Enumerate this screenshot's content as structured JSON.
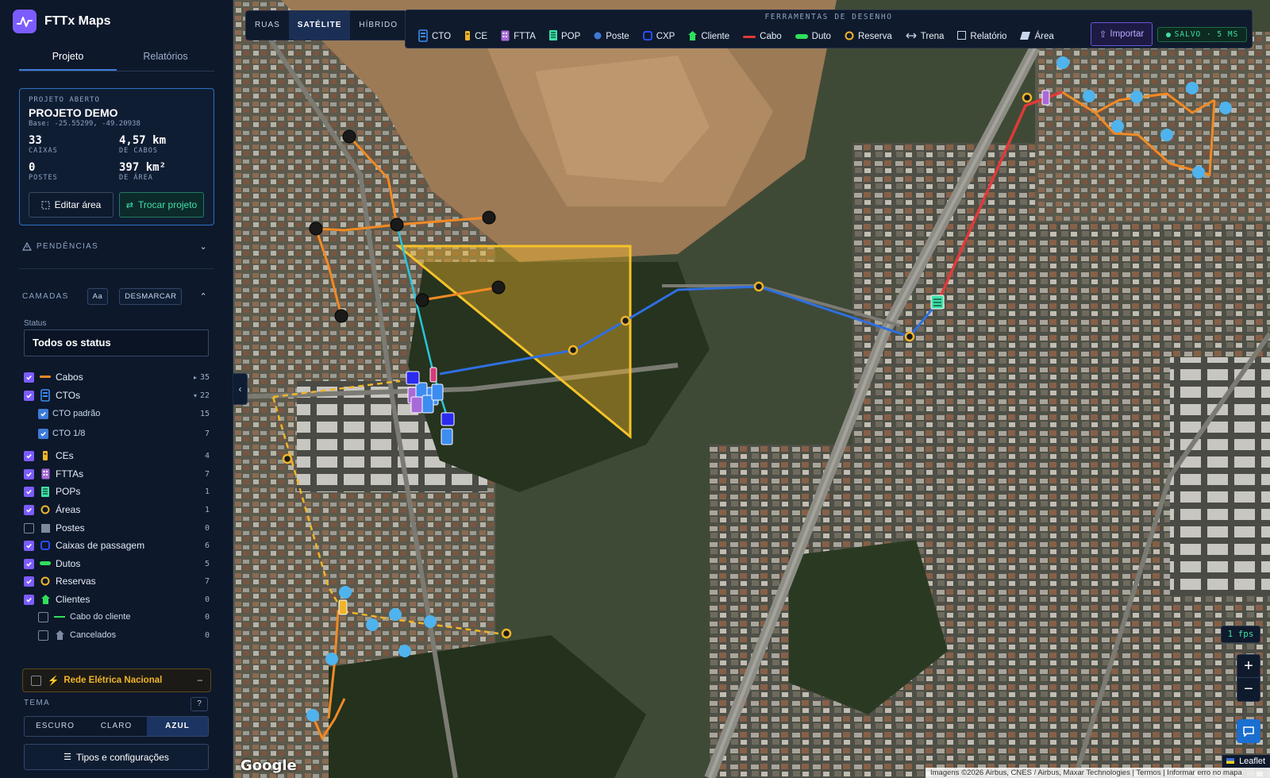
{
  "app": {
    "title": "FTTx Maps"
  },
  "tabs": [
    "Projeto",
    "Relatórios"
  ],
  "project": {
    "label": "PROJETO ABERTO",
    "name": "PROJETO DEMO",
    "base": "Base: -25.55299, -49.20938",
    "stats": [
      {
        "value": "33",
        "label": "CAIXAS"
      },
      {
        "value": "4,57 km",
        "label": "DE CABOS"
      },
      {
        "value": "0",
        "label": "POSTES"
      },
      {
        "value": "397 km²",
        "label": "DE ÁREA"
      }
    ],
    "edit_label": "Editar área",
    "swap_label": "Trocar projeto"
  },
  "pendencias": {
    "label": "PENDÊNCIAS"
  },
  "camadas": {
    "label": "CAMADAS",
    "aa_label": "Aa",
    "desmarcar_label": "DESMARCAR"
  },
  "status": {
    "label": "Status",
    "value": "Todos os status"
  },
  "layers": [
    {
      "name": "Cabos",
      "count": "35",
      "checked": true,
      "prefix": "▸",
      "icon": "cable-line-icon",
      "color": "#f08a24"
    },
    {
      "name": "CTOs",
      "count": "22",
      "checked": true,
      "prefix": "▾",
      "icon": "cto-icon",
      "color": "#3d8cf0"
    },
    {
      "name": "CTO padrão",
      "count": "15",
      "checked": true,
      "sub": true
    },
    {
      "name": "CTO 1/8",
      "count": "7",
      "checked": true,
      "sub": true
    },
    {
      "name": "CEs",
      "count": "4",
      "checked": true,
      "icon": "ce-icon",
      "color": "#f0b429"
    },
    {
      "name": "FTTAs",
      "count": "7",
      "checked": true,
      "icon": "ftta-icon",
      "color": "#a86ad8"
    },
    {
      "name": "POPs",
      "count": "1",
      "checked": true,
      "icon": "pop-icon",
      "color": "#3ee0a8"
    },
    {
      "name": "Áreas",
      "count": "1",
      "checked": true,
      "icon": "area-ring-icon",
      "color": "#f0b429"
    },
    {
      "name": "Postes",
      "count": "0",
      "checked": false,
      "icon": "poste-square-icon",
      "color": "#7d8aa0"
    },
    {
      "name": "Caixas de passagem",
      "count": "6",
      "checked": true,
      "icon": "cxp-icon",
      "color": "#2b4bff"
    },
    {
      "name": "Dutos",
      "count": "5",
      "checked": true,
      "icon": "duto-icon",
      "color": "#2ee05a"
    },
    {
      "name": "Reservas",
      "count": "7",
      "checked": true,
      "icon": "reserva-icon",
      "color": "#f0b429"
    },
    {
      "name": "Clientes",
      "count": "0",
      "checked": true,
      "icon": "cliente-icon",
      "color": "#2ee05a"
    },
    {
      "name": "Cabo do cliente",
      "count": "0",
      "checked": false,
      "sub": true,
      "icon": "cabo-cliente-icon",
      "color": "#2ee05a"
    },
    {
      "name": "Cancelados",
      "count": "0",
      "checked": false,
      "sub": true,
      "icon": "cancelados-icon",
      "color": "#7d8aa0"
    }
  ],
  "rede": {
    "label": "Rede Elétrica Nacional"
  },
  "tema": {
    "label": "TEMA",
    "help": "?",
    "options": [
      "ESCURO",
      "CLARO",
      "AZUL"
    ],
    "active": "AZUL"
  },
  "tipos_label": "Tipos e configurações",
  "basemap": {
    "options": [
      "RUAS",
      "SATÉLITE",
      "HÍBRIDO"
    ],
    "active": "SATÉLITE"
  },
  "toolbar": {
    "title": "FERRAMENTAS DE DESENHO",
    "tools": [
      {
        "label": "CTO",
        "icon": "cto-icon",
        "color": "#3d8cf0"
      },
      {
        "label": "CE",
        "icon": "ce-icon",
        "color": "#f0b429"
      },
      {
        "label": "FTTA",
        "icon": "ftta-icon",
        "color": "#a86ad8"
      },
      {
        "label": "POP",
        "icon": "pop-icon",
        "color": "#3ee0a8"
      },
      {
        "label": "Poste",
        "icon": "poste-dot-icon",
        "color": "#3d7bd8"
      },
      {
        "label": "CXP",
        "icon": "cxp-icon",
        "color": "#2b4bff"
      },
      {
        "label": "Cliente",
        "icon": "cliente-icon",
        "color": "#2ee05a"
      },
      {
        "label": "Cabo",
        "icon": "cabo-line-icon",
        "color": "#e03a3a"
      },
      {
        "label": "Duto",
        "icon": "duto-line-icon",
        "color": "#2ee05a"
      },
      {
        "label": "Reserva",
        "icon": "reserva-icon",
        "color": "#f0b429"
      },
      {
        "label": "Trena",
        "icon": "trena-icon",
        "color": "#c9d6ea"
      },
      {
        "label": "Relatório",
        "icon": "relatorio-icon",
        "color": "#c9d6ea"
      },
      {
        "label": "Área",
        "icon": "area-icon",
        "color": "#c9d6ea"
      }
    ],
    "import_label": "Importar",
    "saved_label": "SALVO · 5 MS"
  },
  "map": {
    "fps": "1 fps",
    "zoom_in": "+",
    "zoom_out": "−",
    "google": "Google",
    "leaflet": "Leaflet",
    "attribution": "Imagens ©2026 Airbus, CNES / Airbus, Maxar Technologies  |  Termos  |  Informar erro no mapa"
  },
  "colors": {
    "accent": "#7c5cff",
    "selected": "#3d7bd8",
    "success": "#3ee0a8",
    "warning": "#f0b429"
  }
}
